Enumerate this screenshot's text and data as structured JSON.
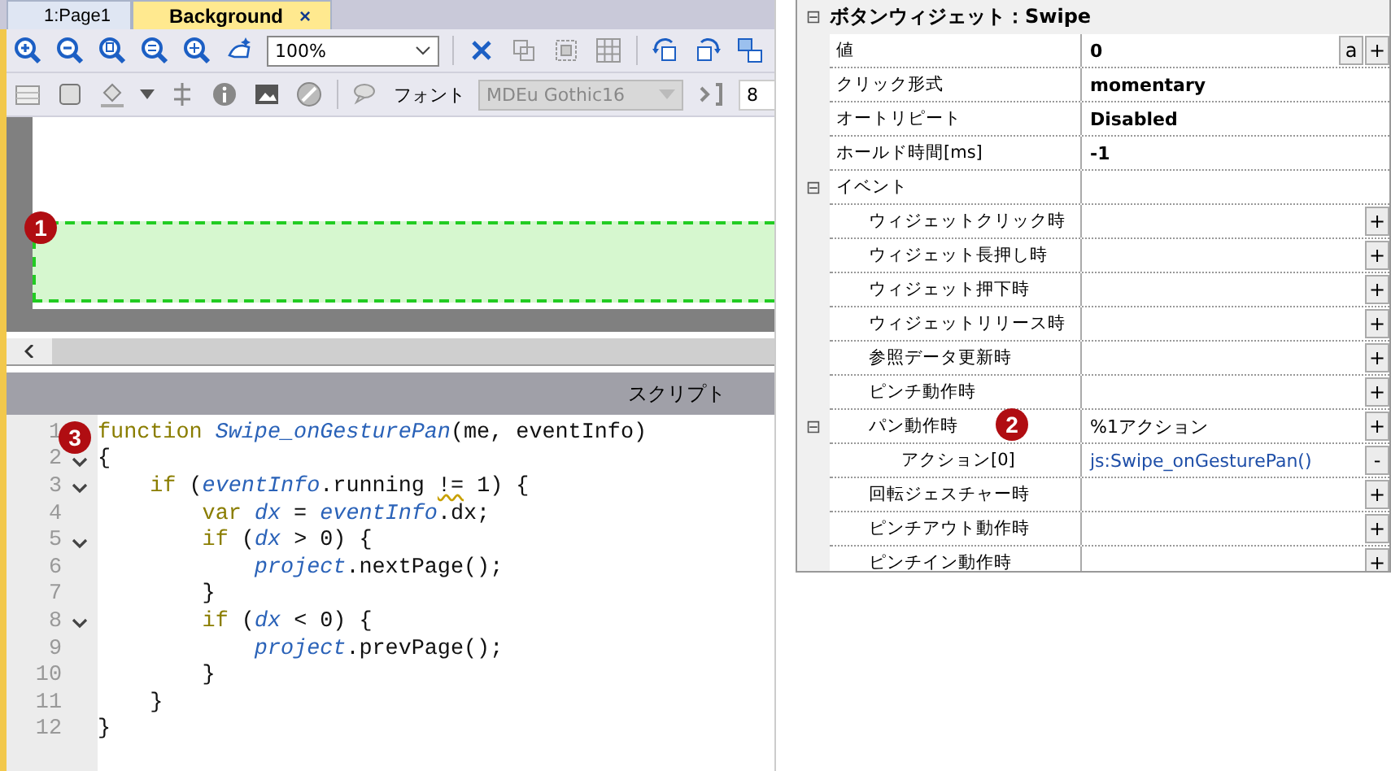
{
  "tabs": [
    {
      "label": "1:Page1",
      "selected": false
    },
    {
      "label": "Background",
      "selected": true,
      "close": "×"
    }
  ],
  "toolbar": {
    "zoom": "100%",
    "font_label": "フォント",
    "font_combo": {
      "value": "MDEu Gothic16",
      "disabled": true
    },
    "size_combo": "8"
  },
  "script_header": "スクリプト",
  "code": [
    {
      "number": "1",
      "tokens": [
        {
          "kind": "kw",
          "text": "function "
        },
        {
          "kind": "ref",
          "text": "Swipe_onGesturePan"
        },
        {
          "kind": "plain",
          "text": "(me, eventInfo)"
        }
      ]
    },
    {
      "number": "2",
      "fold": true,
      "tokens": [
        {
          "kind": "plain",
          "text": "{"
        }
      ]
    },
    {
      "number": "3",
      "fold": true,
      "tokens": [
        {
          "kind": "kw",
          "text": "    if "
        },
        {
          "kind": "plain",
          "text": "("
        },
        {
          "kind": "ref",
          "text": "eventInfo"
        },
        {
          "kind": "plain",
          "text": ".running "
        },
        {
          "kind": "warn",
          "text": "!="
        },
        {
          "kind": "plain",
          "text": " 1) {"
        }
      ]
    },
    {
      "number": "4",
      "fold": false,
      "tokens": [
        {
          "kind": "kw",
          "text": "        var "
        },
        {
          "kind": "ref",
          "text": "dx"
        },
        {
          "kind": "plain",
          "text": " = "
        },
        {
          "kind": "ref",
          "text": "eventInfo"
        },
        {
          "kind": "plain",
          "text": ".dx;"
        }
      ]
    },
    {
      "number": "5",
      "fold": true,
      "tokens": [
        {
          "kind": "kw",
          "text": "        if "
        },
        {
          "kind": "plain",
          "text": "("
        },
        {
          "kind": "ref",
          "text": "dx"
        },
        {
          "kind": "plain",
          "text": " > 0) {"
        }
      ]
    },
    {
      "number": "6",
      "fold": false,
      "tokens": [
        {
          "kind": "ref",
          "text": "            project"
        },
        {
          "kind": "plain",
          "text": ".nextPage();"
        }
      ]
    },
    {
      "number": "7",
      "fold": false,
      "tokens": [
        {
          "kind": "plain",
          "text": "        }"
        }
      ]
    },
    {
      "number": "8",
      "fold": true,
      "tokens": [
        {
          "kind": "kw",
          "text": "        if "
        },
        {
          "kind": "plain",
          "text": "("
        },
        {
          "kind": "ref",
          "text": "dx"
        },
        {
          "kind": "plain",
          "text": " < 0) {"
        }
      ]
    },
    {
      "number": "9",
      "fold": false,
      "tokens": [
        {
          "kind": "ref",
          "text": "            project"
        },
        {
          "kind": "plain",
          "text": ".prevPage();"
        }
      ]
    },
    {
      "number": "10",
      "fold": false,
      "tokens": [
        {
          "kind": "plain",
          "text": "        }"
        }
      ]
    },
    {
      "number": "11",
      "fold": false,
      "tokens": [
        {
          "kind": "plain",
          "text": "    }"
        }
      ]
    },
    {
      "number": "12",
      "fold": false,
      "tokens": [
        {
          "kind": "plain",
          "text": "}"
        }
      ]
    }
  ],
  "properties": {
    "expand_sign": "⊟",
    "title": "ボタンウィジェット：Swipe",
    "expanded": true,
    "children": [
      {
        "kind": "setting",
        "label": "値",
        "value": "0",
        "buttons": [
          "a",
          "+"
        ]
      },
      {
        "kind": "setting",
        "label": "クリック形式",
        "value": "momentary"
      },
      {
        "kind": "setting",
        "label": "オートリピート",
        "value": "Disabled"
      },
      {
        "kind": "setting",
        "label": "ホールド時間[ms]",
        "value": "-1"
      },
      {
        "label": "イベント",
        "expanded": true,
        "children": [
          {
            "label": "ウィジェットクリック時",
            "buttons": [
              "+"
            ]
          },
          {
            "label": "ウィジェット長押し時",
            "buttons": [
              "+"
            ]
          },
          {
            "label": "ウィジェット押下時",
            "buttons": [
              "+"
            ]
          },
          {
            "label": "ウィジェットリリース時",
            "buttons": [
              "+"
            ]
          },
          {
            "label": "参照データ更新時",
            "buttons": [
              "+"
            ]
          },
          {
            "label": "ピンチ動作時",
            "buttons": [
              "+"
            ]
          },
          {
            "label": "パン動作時",
            "value": "%1アクション",
            "buttons": [
              "+"
            ],
            "expanded": true,
            "children": [
              {
                "kind": "action",
                "label": "アクション[0]",
                "value": "js:Swipe_onGesturePan()",
                "buttons": [
                  "-"
                ]
              }
            ]
          },
          {
            "label": "回転ジェスチャー時",
            "buttons": [
              "+"
            ]
          },
          {
            "label": "ピンチアウト動作時",
            "buttons": [
              "+"
            ]
          },
          {
            "label": "ピンチイン動作時",
            "buttons": [
              "+"
            ]
          }
        ]
      }
    ]
  },
  "callouts": [
    "1",
    "2",
    "3"
  ]
}
